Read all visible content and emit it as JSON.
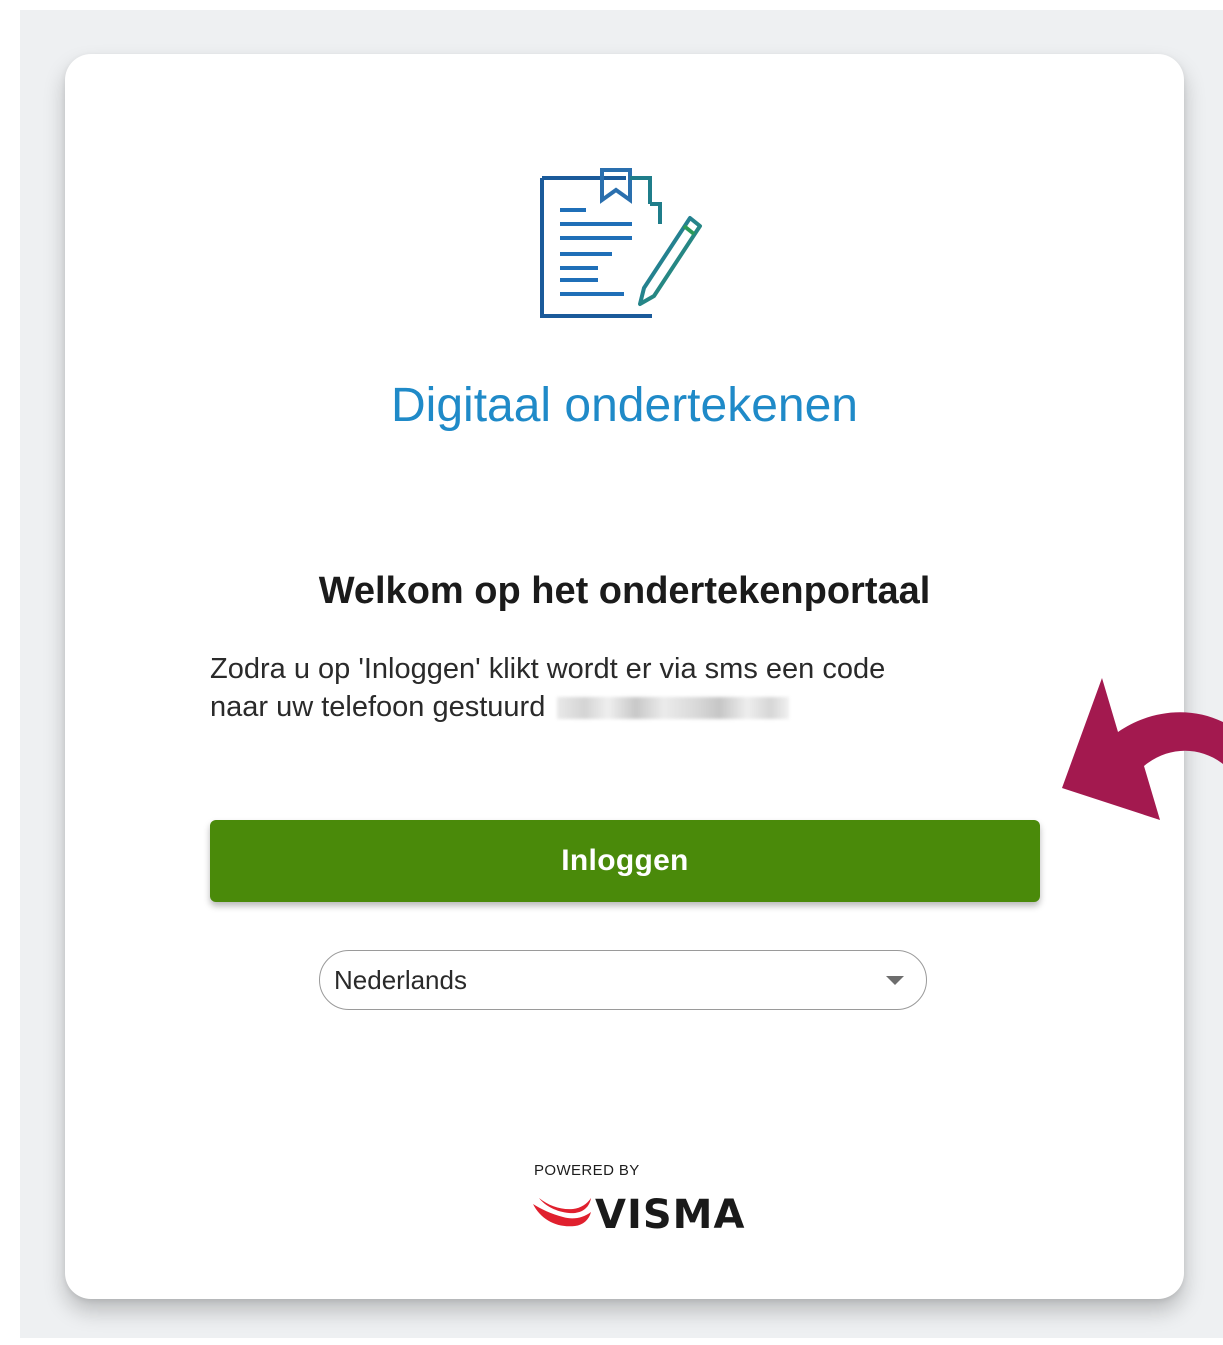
{
  "header": {
    "app_title": "Digitaal ondertekenen",
    "icon": "document-sign-icon"
  },
  "main": {
    "welcome_title": "Welkom op het ondertekenportaal",
    "description_line1": "Zodra u op 'Inloggen' klikt wordt er via sms een code",
    "description_line2": "naar uw telefoon gestuurd"
  },
  "actions": {
    "login_label": "Inloggen",
    "login_color": "#4a8a0a"
  },
  "language": {
    "selected": "Nederlands",
    "icon": "caret-down-icon"
  },
  "footer": {
    "powered_by": "POWERED BY",
    "brand": "VISMA"
  },
  "colors": {
    "title": "#1f8ac8",
    "annotation_arrow": "#a3194f",
    "background": "#eef0f2"
  }
}
